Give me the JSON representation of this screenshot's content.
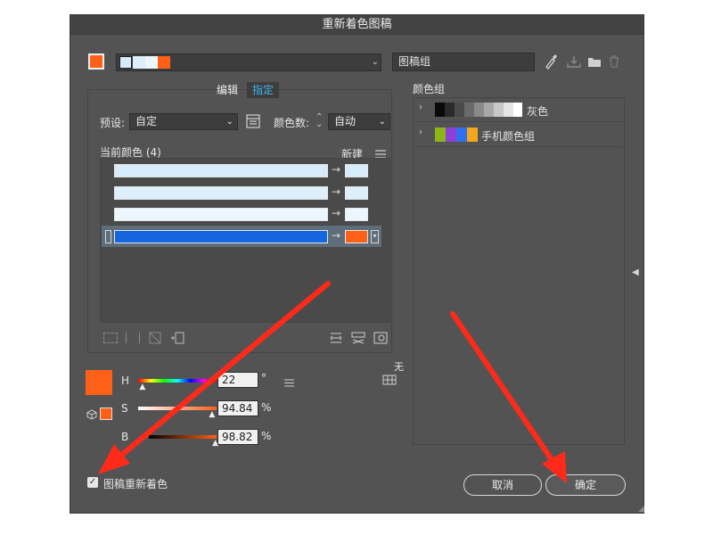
{
  "window": {
    "title": "重新着色图稿"
  },
  "top": {
    "artwork_name": "图稿组"
  },
  "tabs": {
    "edit": "编辑",
    "assign": "指定"
  },
  "preset": {
    "label": "预设:",
    "value": "自定"
  },
  "color_count": {
    "label": "颜色数:",
    "value": "自动"
  },
  "current_colors": {
    "label": "当前颜色 (4)",
    "new_label": "新建"
  },
  "color_rows": [
    {
      "current": "#d6ecfb",
      "new": "#d6ecfb"
    },
    {
      "current": "#dceffb",
      "new": "#dceffb"
    },
    {
      "current": "#ecf6fd",
      "new": "#ecf6fd"
    },
    {
      "current": "#1466e0",
      "new": "#ff6018"
    }
  ],
  "color_groups": {
    "label": "颜色组",
    "items": [
      {
        "name": "灰色",
        "swatches": [
          "#0a0a0a",
          "#2a2a2a",
          "#4a4a4a",
          "#6a6a6a",
          "#8a8a8a",
          "#a8a8a8",
          "#c8c8c8",
          "#e4e4e4",
          "#ffffff"
        ]
      },
      {
        "name": "手机颜色组",
        "swatches": [
          "#8db61a",
          "#8d3fd6",
          "#2f6ff0",
          "#f3a81c"
        ]
      }
    ]
  },
  "hsb": {
    "h_label": "H",
    "h_value": "22",
    "h_unit": "°",
    "s_label": "S",
    "s_value": "94.84",
    "s_unit": "%",
    "b_label": "B",
    "b_value": "98.82",
    "b_unit": "%",
    "hue_fraction": 0.061,
    "sat_fraction": 0.948,
    "bri_fraction": 0.988
  },
  "none_label": "无",
  "footer": {
    "recolor_label": "图稿重新着色",
    "recolor_checked": true,
    "cancel": "取消",
    "ok": "确定"
  },
  "colors": {
    "accent": "#3fb2f5",
    "swatch": "#ff6018",
    "annotation": "#ff2a1a"
  }
}
